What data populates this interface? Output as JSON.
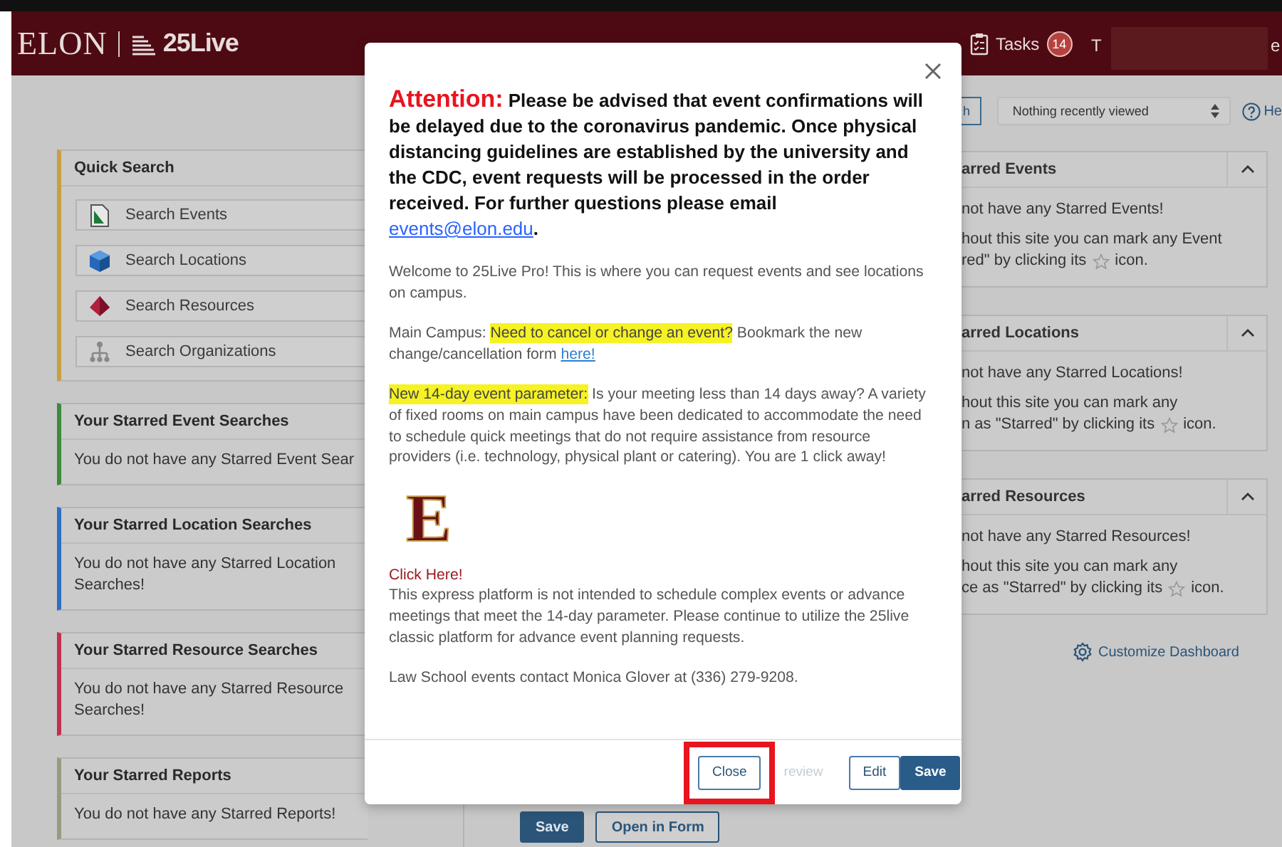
{
  "header": {
    "logo": "ELON",
    "product": "25Live",
    "tasks_label": "Tasks",
    "tasks_count": "14",
    "user_initial": "T",
    "user_tail": "e"
  },
  "toolbar": {
    "button_fragment": "h",
    "recent_select": "Nothing recently viewed",
    "help_fragment": "He"
  },
  "quick_search": {
    "title": "Quick Search",
    "items": [
      {
        "label": "Search Events",
        "kind": "events"
      },
      {
        "label": "Search Locations",
        "kind": "locations"
      },
      {
        "label": "Search Resources",
        "kind": "resources"
      },
      {
        "label": "Search Organizations",
        "kind": "organizations"
      }
    ]
  },
  "starred_searches": [
    {
      "title": "Your Starred Event Searches",
      "message": "You do not have any Starred Event Sear",
      "color": "#3c8a3c"
    },
    {
      "title": "Your Starred Location Searches",
      "message": "You do not have any Starred Location Searches!",
      "color": "#2f6fc0"
    },
    {
      "title": "Your Starred Resource Searches",
      "message": "You do not have any Starred Resource Searches!",
      "color": "#c0304f"
    },
    {
      "title": "Your Starred Reports",
      "message": "You do not have any Starred Reports!",
      "color": "#9a9a80"
    }
  ],
  "starred_cards": [
    {
      "title": "arred Events",
      "expanded": true,
      "message": "not have any Starred Events!",
      "hint": "hout this site you can mark any Event",
      "hint_before_star": "red\" by clicking its",
      "hint_after_star": "icon."
    },
    {
      "title": "arred Locations",
      "expanded": true,
      "message": "not have any Starred Locations!",
      "hint": "hout this site you can mark any",
      "hint_before_star": "n as \"Starred\" by clicking its",
      "hint_after_star": "icon."
    },
    {
      "title": "arred Resources",
      "expanded": true,
      "message": "not have any Starred Resources!",
      "hint": "hout this site you can mark any",
      "hint_before_star": "ce as \"Starred\" by clicking its",
      "hint_after_star": "icon."
    }
  ],
  "customize_link": "Customize Dashboard",
  "form_buttons": [
    {
      "label": "Save",
      "kind": "primary"
    },
    {
      "label": "Open in Form",
      "kind": "outline"
    }
  ],
  "modal": {
    "content": [
      {
        "kind": "notice",
        "segments": [
          {
            "kind": "alert",
            "text": "Attention:"
          },
          {
            "kind": "text",
            "text": " Please be advised that event confirmations will be delayed due to the coronavirus pandemic. Once physical distancing guidelines are established by the university and the CDC, event requests will be processed in the order received.  For further questions please email "
          },
          {
            "kind": "link",
            "text": "events@elon.edu"
          },
          {
            "kind": "text",
            "text": "."
          }
        ]
      },
      {
        "kind": "paragraph",
        "segments": [
          {
            "kind": "text",
            "text": "Welcome to 25Live Pro! This is where you can request events and see locations on campus."
          }
        ]
      },
      {
        "kind": "paragraph",
        "segments": [
          {
            "kind": "text",
            "text": "Main Campus: "
          },
          {
            "kind": "highlight",
            "text": "Need to cancel or change an event?"
          },
          {
            "kind": "text",
            "text": " Bookmark the new change/cancellation form "
          },
          {
            "kind": "link",
            "text": "here!"
          }
        ]
      },
      {
        "kind": "paragraph",
        "segments": [
          {
            "kind": "highlight",
            "text": "New 14-day event parameter:"
          },
          {
            "kind": "text",
            "text": " Is your meeting less than 14 days away? A variety of fixed rooms on main campus have been dedicated to accommodate the need to schedule quick meetings that do not require assistance from resource providers (i.e. technology, physical plant or catering). You are 1 click away!"
          }
        ]
      },
      {
        "kind": "logo",
        "text": "E"
      },
      {
        "kind": "link",
        "text": "Click Here!"
      },
      {
        "kind": "paragraph",
        "segments": [
          {
            "kind": "text",
            "text": "This express platform is not intended to schedule complex events or advance meetings that meet the 14-day parameter. Please continue to utilize the 25live classic platform for advance event planning requests."
          }
        ]
      },
      {
        "kind": "paragraph",
        "segments": [
          {
            "kind": "text",
            "text": "Law School events contact Monica Glover at (336) 279-9208."
          }
        ]
      }
    ],
    "buttons": [
      {
        "label": "Close",
        "kind": "outline",
        "highlighted": true
      },
      {
        "label": "review",
        "kind": "faded",
        "highlighted": false
      },
      {
        "label": "Edit",
        "kind": "outline",
        "highlighted": false
      },
      {
        "label": "Save",
        "kind": "primary",
        "highlighted": false
      }
    ]
  }
}
